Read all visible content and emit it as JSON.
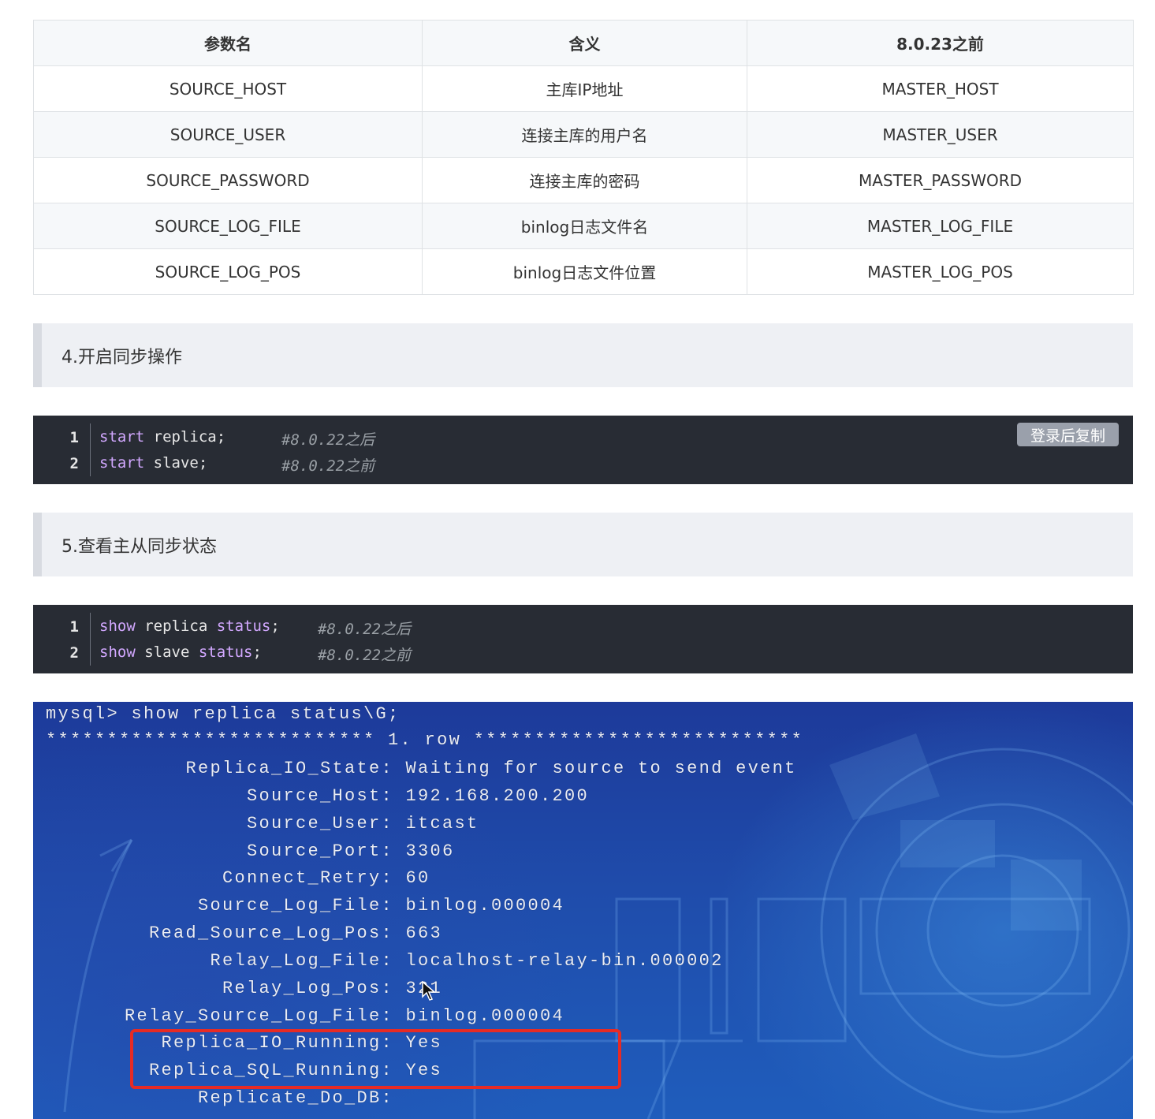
{
  "table": {
    "headers": [
      "参数名",
      "含义",
      "8.0.23之前"
    ],
    "rows": [
      [
        "SOURCE_HOST",
        "主库IP地址",
        "MASTER_HOST"
      ],
      [
        "SOURCE_USER",
        "连接主库的用户名",
        "MASTER_USER"
      ],
      [
        "SOURCE_PASSWORD",
        "连接主库的密码",
        "MASTER_PASSWORD"
      ],
      [
        "SOURCE_LOG_FILE",
        "binlog日志文件名",
        "MASTER_LOG_FILE"
      ],
      [
        "SOURCE_LOG_POS",
        "binlog日志文件位置",
        "MASTER_LOG_POS"
      ]
    ]
  },
  "section4": {
    "title": "4.开启同步操作"
  },
  "code1": {
    "copy_label": "登录后复制",
    "lines": [
      {
        "no": "1",
        "kw": "start",
        "rest": " replica;",
        "comment": "#8.0.22之后"
      },
      {
        "no": "2",
        "kw": "start",
        "rest": " slave;",
        "comment": "#8.0.22之前"
      }
    ]
  },
  "section5": {
    "title": "5.查看主从同步状态"
  },
  "code2": {
    "lines": [
      {
        "no": "1",
        "kw": "show",
        "mid": " replica ",
        "kw2": "status",
        "rest": ";",
        "comment": "#8.0.22之后"
      },
      {
        "no": "2",
        "kw": "show",
        "mid": " slave ",
        "kw2": "status",
        "rest": ";",
        "comment": "#8.0.22之前"
      }
    ]
  },
  "terminal": {
    "command": "mysql> show replica status\\G;",
    "row_banner": "*************************** 1. row ***************************",
    "fields": [
      {
        "label": "Replica_IO_State:",
        "value": "Waiting for source to send event"
      },
      {
        "label": "Source_Host:",
        "value": "192.168.200.200"
      },
      {
        "label": "Source_User:",
        "value": "itcast"
      },
      {
        "label": "Source_Port:",
        "value": "3306"
      },
      {
        "label": "Connect_Retry:",
        "value": "60"
      },
      {
        "label": "Source_Log_File:",
        "value": "binlog.000004"
      },
      {
        "label": "Read_Source_Log_Pos:",
        "value": "663"
      },
      {
        "label": "Relay_Log_File:",
        "value": "localhost-relay-bin.000002"
      },
      {
        "label": "Relay_Log_Pos:",
        "value": "321"
      },
      {
        "label": "Relay_Source_Log_File:",
        "value": "binlog.000004"
      },
      {
        "label": "Replica_IO_Running:",
        "value": "Yes"
      },
      {
        "label": "Replica_SQL_Running:",
        "value": "Yes"
      },
      {
        "label": "Replicate_Do_DB:",
        "value": ""
      }
    ]
  }
}
